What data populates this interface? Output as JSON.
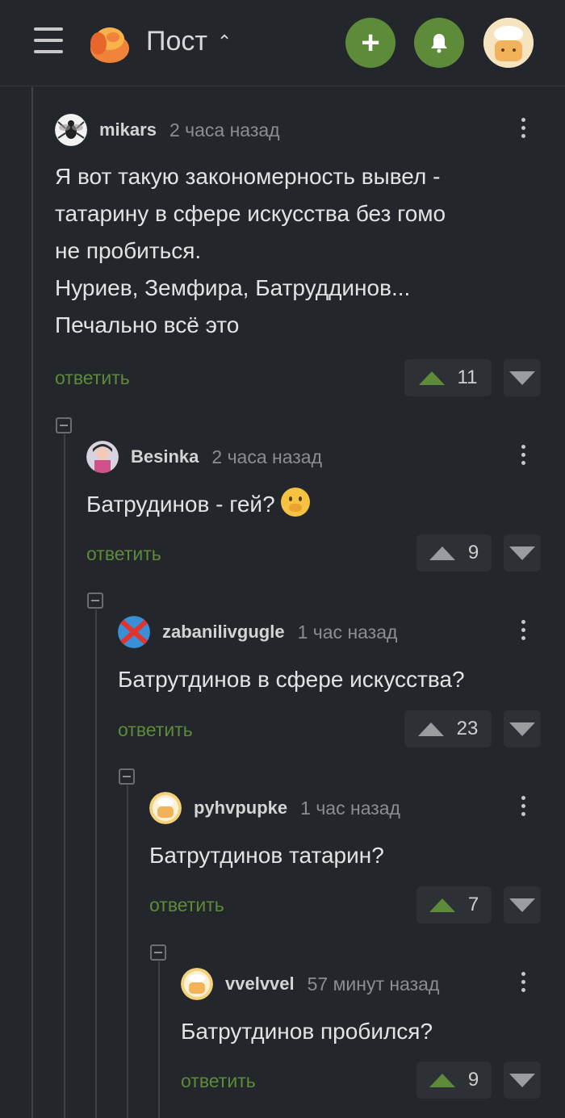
{
  "header": {
    "title": "Пост",
    "title_chevron": "^",
    "add_button": "+",
    "icons": [
      "menu-icon",
      "logo-icon",
      "plus-icon",
      "bell-icon",
      "user-avatar"
    ],
    "accent_color": "#5d8b3a"
  },
  "comments": [
    {
      "user": "mikars",
      "time": "2 часа назад",
      "lines": [
        "Я вот такую закономерность вывел -",
        "татарину в сфере искусства без гомо",
        "не пробиться.",
        "Нуриев, Земфира, Батруддинов...",
        "Печально всё это"
      ],
      "reply": "ответить",
      "votes": "11",
      "upvoted": true
    },
    {
      "user": "Besinka",
      "time": "2 часа назад",
      "text": "Батрудинов - гей?",
      "reply": "ответить",
      "votes": "9",
      "upvoted": false
    },
    {
      "user": "zabanilivgugle",
      "time": "1 час назад",
      "text": "Батрутдинов в сфере искусства?",
      "reply": "ответить",
      "votes": "23",
      "upvoted": false
    },
    {
      "user": "pyhvpupke",
      "time": "1 час назад",
      "text": "Батрутдинов татарин?",
      "reply": "ответить",
      "votes": "7",
      "upvoted": true
    },
    {
      "user": "vvelvvel",
      "time": "57 минут назад",
      "text": "Батрутдинов пробился?",
      "reply": "ответить",
      "votes": "9",
      "upvoted": true
    }
  ]
}
